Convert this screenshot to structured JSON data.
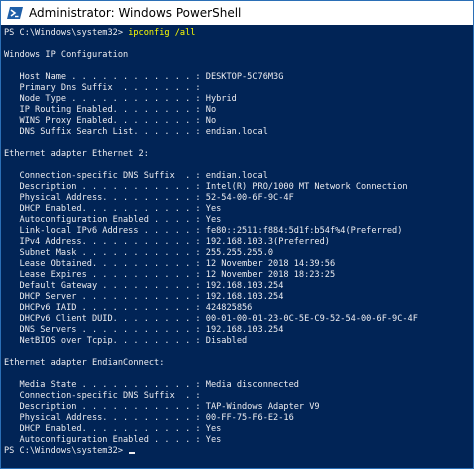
{
  "window": {
    "title": "Administrator: Windows PowerShell",
    "colors": {
      "console_bg": "#012456",
      "text": "#eeedf0",
      "command": "#ffff00",
      "border": "#2b6fb6"
    },
    "icon": "powershell-icon"
  },
  "console": {
    "prompt_1": "PS C:\\Windows\\system32> ",
    "command_1": "ipconfig /all",
    "lines": [
      "",
      "Windows IP Configuration",
      "",
      "   Host Name . . . . . . . . . . . . : DESKTOP-5C76M3G",
      "   Primary Dns Suffix  . . . . . . . :",
      "   Node Type . . . . . . . . . . . . : Hybrid",
      "   IP Routing Enabled. . . . . . . . : No",
      "   WINS Proxy Enabled. . . . . . . . : No",
      "   DNS Suffix Search List. . . . . . : endian.local",
      "",
      "Ethernet adapter Ethernet 2:",
      "",
      "   Connection-specific DNS Suffix  . : endian.local",
      "   Description . . . . . . . . . . . : Intel(R) PRO/1000 MT Network Connection",
      "   Physical Address. . . . . . . . . : 52-54-00-6F-9C-4F",
      "   DHCP Enabled. . . . . . . . . . . : Yes",
      "   Autoconfiguration Enabled . . . . : Yes",
      "   Link-local IPv6 Address . . . . . : fe80::2511:f884:5d1f:b54f%4(Preferred)",
      "   IPv4 Address. . . . . . . . . . . : 192.168.103.3(Preferred)",
      "   Subnet Mask . . . . . . . . . . . : 255.255.255.0",
      "   Lease Obtained. . . . . . . . . . : 12 November 2018 14:39:56",
      "   Lease Expires . . . . . . . . . . : 12 November 2018 18:23:25",
      "   Default Gateway . . . . . . . . . : 192.168.103.254",
      "   DHCP Server . . . . . . . . . . . : 192.168.103.254",
      "   DHCPv6 IAID . . . . . . . . . . . : 424825856",
      "   DHCPv6 Client DUID. . . . . . . . : 00-01-00-01-23-0C-5E-C9-52-54-00-6F-9C-4F",
      "   DNS Servers . . . . . . . . . . . : 192.168.103.254",
      "   NetBIOS over Tcpip. . . . . . . . : Disabled",
      "",
      "Ethernet adapter EndianConnect:",
      "",
      "   Media State . . . . . . . . . . . : Media disconnected",
      "   Connection-specific DNS Suffix  . :",
      "   Description . . . . . . . . . . . : TAP-Windows Adapter V9",
      "   Physical Address. . . . . . . . . : 00-FF-75-F6-E2-16",
      "   DHCP Enabled. . . . . . . . . . . : Yes",
      "   Autoconfiguration Enabled . . . . : Yes"
    ],
    "prompt_2": "PS C:\\Windows\\system32> "
  }
}
